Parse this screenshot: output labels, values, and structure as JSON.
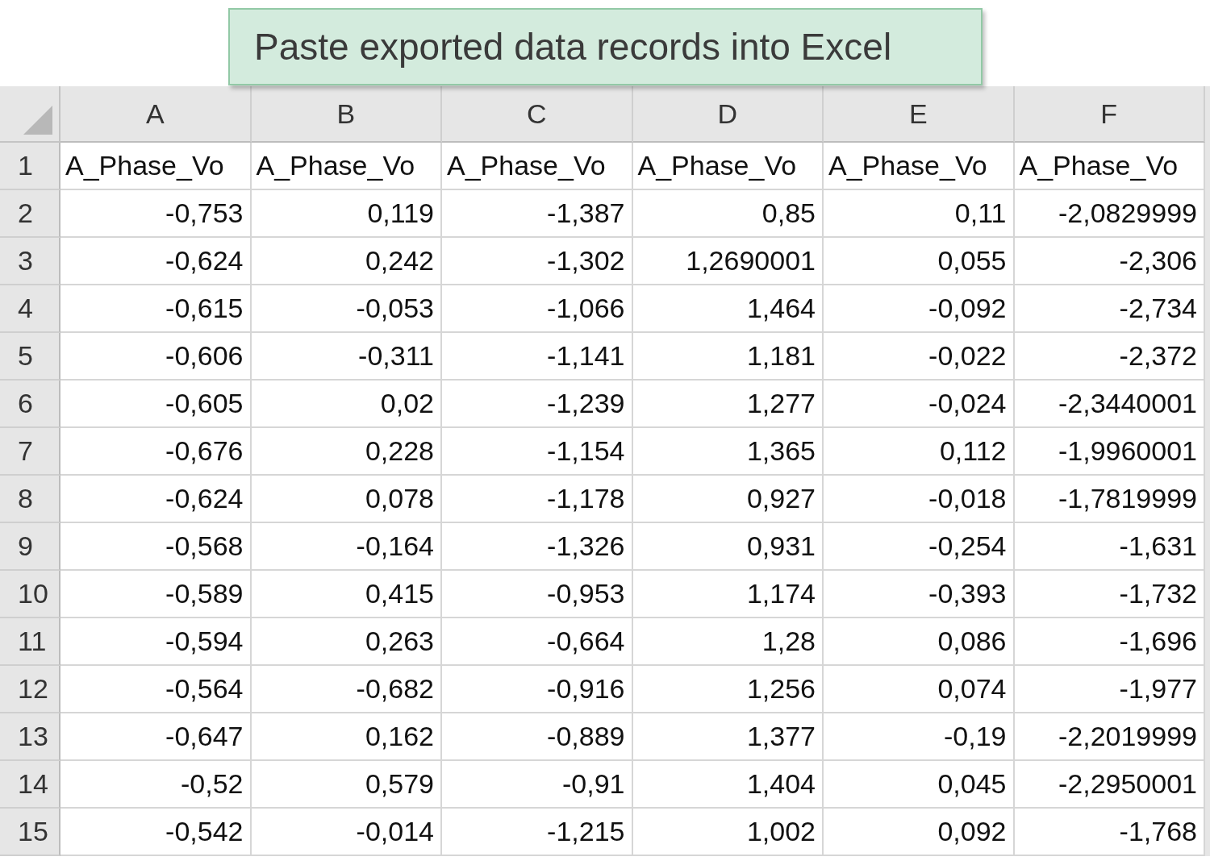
{
  "callout": {
    "text": "Paste exported data records into Excel"
  },
  "sheet": {
    "columns": [
      "A",
      "B",
      "C",
      "D",
      "E",
      "F"
    ],
    "rows": [
      {
        "number": "1",
        "kind": "text",
        "cells": [
          "A_Phase_Vo",
          "A_Phase_Vo",
          "A_Phase_Vo",
          "A_Phase_Vo",
          "A_Phase_Vo",
          "A_Phase_Vo"
        ]
      },
      {
        "number": "2",
        "kind": "number",
        "cells": [
          "-0,753",
          "0,119",
          "-1,387",
          "0,85",
          "0,11",
          "-2,0829999"
        ]
      },
      {
        "number": "3",
        "kind": "number",
        "cells": [
          "-0,624",
          "0,242",
          "-1,302",
          "1,2690001",
          "0,055",
          "-2,306"
        ]
      },
      {
        "number": "4",
        "kind": "number",
        "cells": [
          "-0,615",
          "-0,053",
          "-1,066",
          "1,464",
          "-0,092",
          "-2,734"
        ]
      },
      {
        "number": "5",
        "kind": "number",
        "cells": [
          "-0,606",
          "-0,311",
          "-1,141",
          "1,181",
          "-0,022",
          "-2,372"
        ]
      },
      {
        "number": "6",
        "kind": "number",
        "cells": [
          "-0,605",
          "0,02",
          "-1,239",
          "1,277",
          "-0,024",
          "-2,3440001"
        ]
      },
      {
        "number": "7",
        "kind": "number",
        "cells": [
          "-0,676",
          "0,228",
          "-1,154",
          "1,365",
          "0,112",
          "-1,9960001"
        ]
      },
      {
        "number": "8",
        "kind": "number",
        "cells": [
          "-0,624",
          "0,078",
          "-1,178",
          "0,927",
          "-0,018",
          "-1,7819999"
        ]
      },
      {
        "number": "9",
        "kind": "number",
        "cells": [
          "-0,568",
          "-0,164",
          "-1,326",
          "0,931",
          "-0,254",
          "-1,631"
        ]
      },
      {
        "number": "10",
        "kind": "number",
        "cells": [
          "-0,589",
          "0,415",
          "-0,953",
          "1,174",
          "-0,393",
          "-1,732"
        ]
      },
      {
        "number": "11",
        "kind": "number",
        "cells": [
          "-0,594",
          "0,263",
          "-0,664",
          "1,28",
          "0,086",
          "-1,696"
        ]
      },
      {
        "number": "12",
        "kind": "number",
        "cells": [
          "-0,564",
          "-0,682",
          "-0,916",
          "1,256",
          "0,074",
          "-1,977"
        ]
      },
      {
        "number": "13",
        "kind": "number",
        "cells": [
          "-0,647",
          "0,162",
          "-0,889",
          "1,377",
          "-0,19",
          "-2,2019999"
        ]
      },
      {
        "number": "14",
        "kind": "number",
        "cells": [
          "-0,52",
          "0,579",
          "-0,91",
          "1,404",
          "0,045",
          "-2,2950001"
        ]
      },
      {
        "number": "15",
        "kind": "number",
        "cells": [
          "-0,542",
          "-0,014",
          "-1,215",
          "1,002",
          "0,092",
          "-1,768"
        ]
      }
    ]
  }
}
